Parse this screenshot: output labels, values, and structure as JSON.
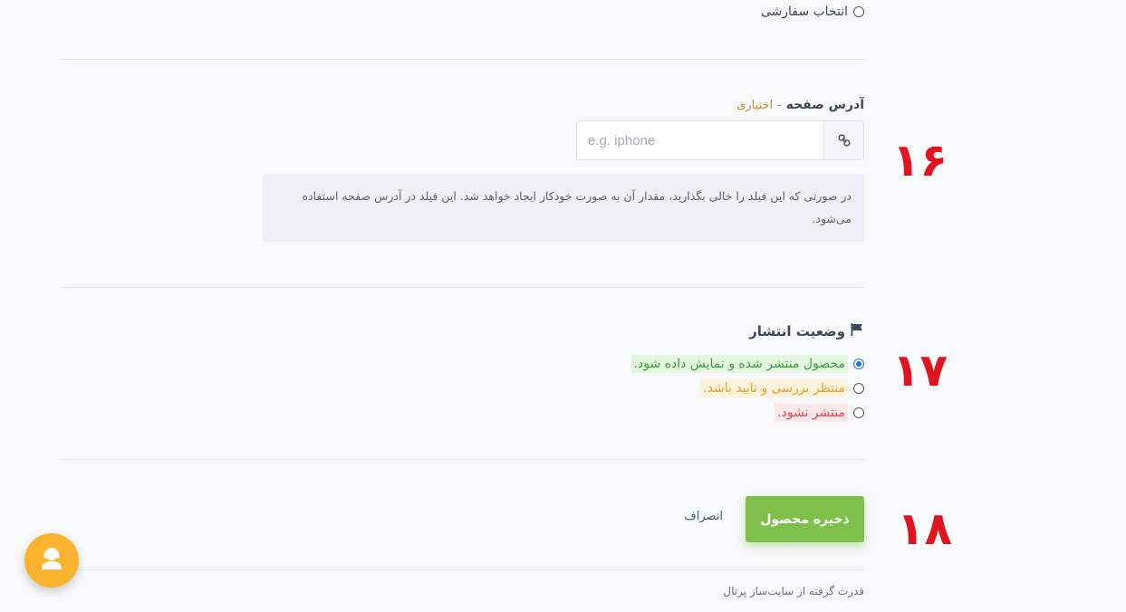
{
  "top_option": {
    "label": "انتخاب سفارشی",
    "checked": false
  },
  "slug": {
    "label": "آدرس صفحه",
    "separator": "-",
    "optional": "اختیاری",
    "placeholder": "e.g. iphone",
    "value": "",
    "addon_icon": "link-icon",
    "help": "در صورتی که این فیلد را خالی بگذارید، مقدار آن به صورت خودکار ایجاد خواهد شد. این فیلد در آدرس صفحه استفاده می‌شود."
  },
  "publish": {
    "title": "وضعیت انتشار",
    "title_icon": "flag-icon",
    "options": [
      {
        "label": "محصول منتشر شده و نمایش داده شود.",
        "checked": true,
        "color": "#3f9c3a"
      },
      {
        "label": "منتظر بررسی و تایید باشد.",
        "checked": false,
        "color": "#e8a02a"
      },
      {
        "label": "منتشر نشود.",
        "checked": false,
        "color": "#e0485a"
      }
    ]
  },
  "actions": {
    "save_label": "ذخیره محصول",
    "cancel_label": "انصراف"
  },
  "footer": {
    "text": "قدرت گرفته از سایت‌ساز پرتال"
  },
  "annotations": {
    "a16": "۱۶",
    "a17": "۱۷",
    "a18": "۱۸"
  },
  "support_icon": "support-agent-icon",
  "colors": {
    "accent_save": "#7fc04b",
    "annotation": "#e0141e",
    "support": "#f9b32f"
  }
}
